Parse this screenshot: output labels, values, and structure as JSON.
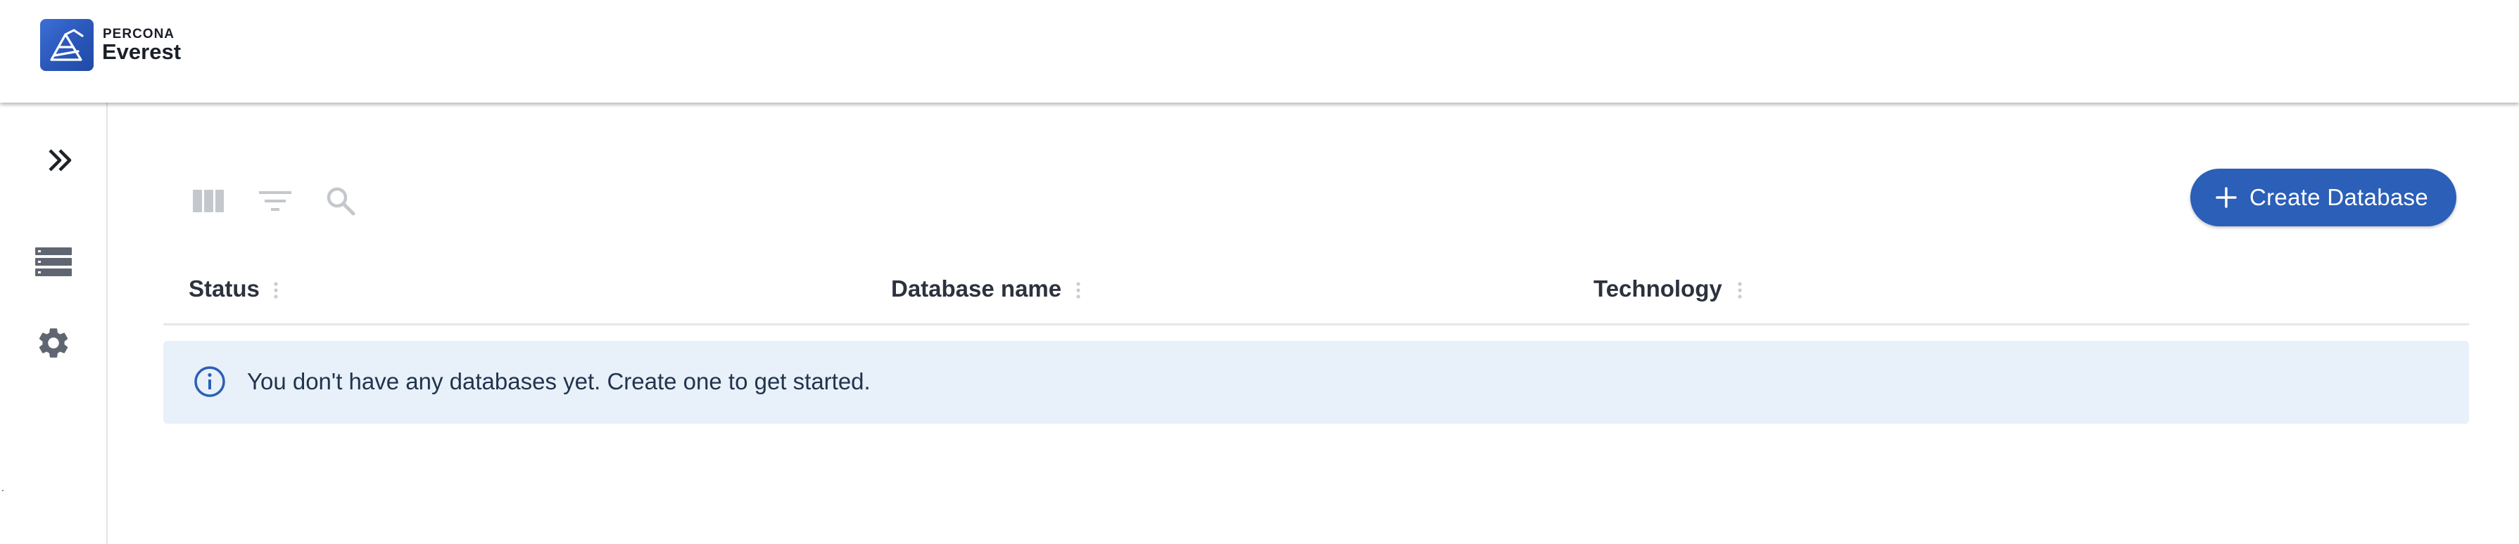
{
  "header": {
    "brand_top": "PERCONA",
    "brand_main": "Everest"
  },
  "sidebar": {
    "items": [
      {
        "icon": "expand-double-chevron-icon"
      },
      {
        "icon": "databases-list-icon"
      },
      {
        "icon": "gear-icon"
      }
    ]
  },
  "toolbar": {
    "icons": [
      "columns-icon",
      "filter-icon",
      "search-icon"
    ],
    "create_label": "Create Database"
  },
  "table": {
    "columns": [
      "Status",
      "Database name",
      "Technology"
    ],
    "empty_message": "You don't have any databases yet. Create one to get started."
  },
  "colors": {
    "accent": "#2b5fb8",
    "alert_bg": "#e8f0fa",
    "info_icon": "#2b5fb8"
  }
}
